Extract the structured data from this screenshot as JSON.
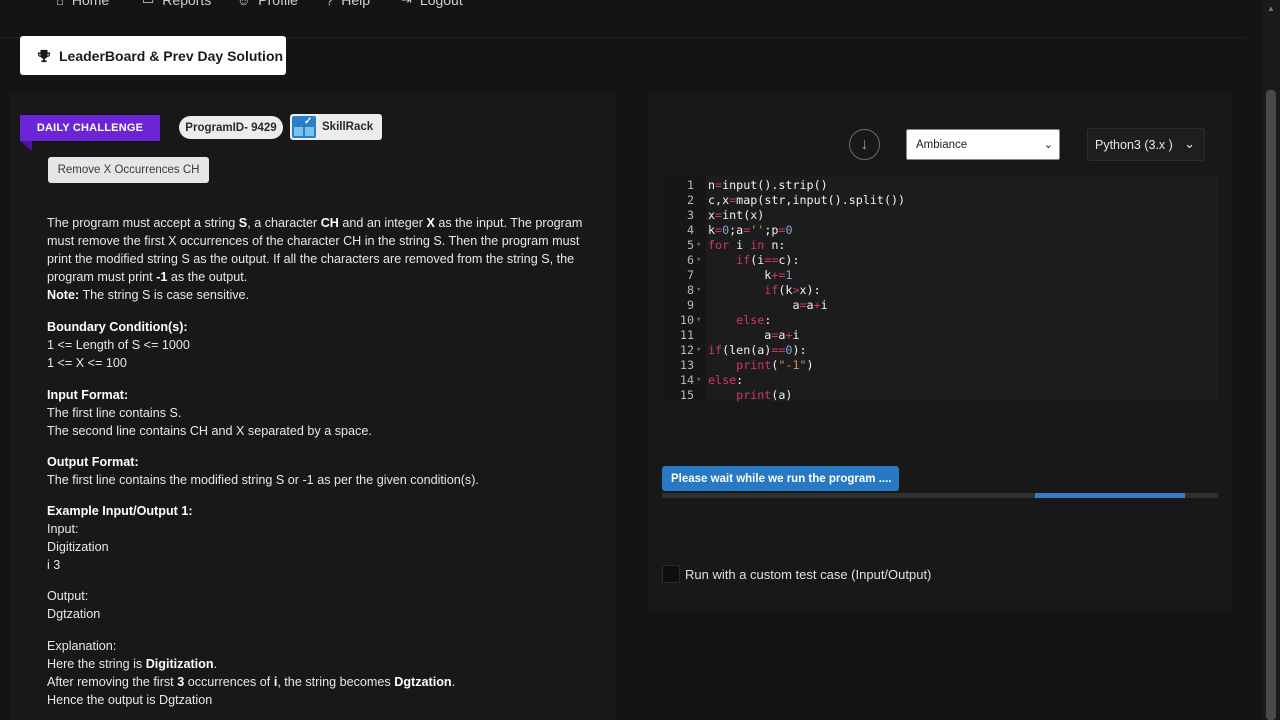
{
  "nav": {
    "items": [
      {
        "label": "Home",
        "icon": "home-icon"
      },
      {
        "label": "Reports",
        "icon": "reports-icon"
      },
      {
        "label": "Profile",
        "icon": "profile-icon"
      },
      {
        "label": "Help",
        "icon": "help-icon"
      },
      {
        "label": "Logout",
        "icon": "logout-icon"
      }
    ]
  },
  "leaderboard_label": "LeaderBoard & Prev Day Solution",
  "problem": {
    "badge": "DAILY CHALLENGE",
    "program_id": "ProgramID- 9429",
    "skillrack": "SkillRack",
    "title": "Remove X Occurrences CH",
    "desc_1a": "The program must accept a string ",
    "desc_1b": "S",
    "desc_1c": ", a character ",
    "desc_1d": "CH",
    "desc_1e": " and an integer ",
    "desc_1f": "X",
    "desc_1g": " as the input. The program must remove the first X occurrences of the character CH in the string S. Then the program must print the modified string S as the output. If all the characters are removed from the string S, the program must print ",
    "desc_1h": "-1",
    "desc_1i": " as the output.",
    "note_label": "Note:",
    "note_text": " The string S is case sensitive.",
    "boundary_title": "Boundary Condition(s):",
    "boundary_1": "1 <= Length of S <= 1000",
    "boundary_2": "1 <= X <= 100",
    "input_title": "Input Format:",
    "input_1": "The first line contains S.",
    "input_2": "The second line contains CH and X separated by a space.",
    "output_title": "Output Format:",
    "output_1": "The first line contains the modified string S or -1 as per the given condition(s).",
    "example_title": "Example Input/Output 1:",
    "ex_input_label": "Input:",
    "ex_input_1": "Digitization",
    "ex_input_2": "i 3",
    "ex_output_label": "Output:",
    "ex_output_1": "Dgtzation",
    "explanation_label": "Explanation:",
    "exp_1a": "Here the string is ",
    "exp_1b": "Digitization",
    "exp_1c": ".",
    "exp_2a": "After removing the first ",
    "exp_2b": "3",
    "exp_2c": " occurrences of ",
    "exp_2d": "i",
    "exp_2e": ", the string becomes ",
    "exp_2f": "Dgtzation",
    "exp_2g": ".",
    "exp_3": "Hence the output is Dgtzation"
  },
  "editor": {
    "theme": "Ambiance",
    "language": "Python3 (3.x )",
    "lines": [
      {
        "n": "1",
        "fold": "",
        "code": "n=input().strip()"
      },
      {
        "n": "2",
        "fold": "",
        "code": "c,x=map(str,input().split())"
      },
      {
        "n": "3",
        "fold": "",
        "code": "x=int(x)"
      },
      {
        "n": "4",
        "fold": "",
        "code": "k=0;a='';p=0"
      },
      {
        "n": "5",
        "fold": "▾",
        "code": "for i in n:"
      },
      {
        "n": "6",
        "fold": "▾",
        "code": "    if(i==c):"
      },
      {
        "n": "7",
        "fold": "",
        "code": "        k+=1"
      },
      {
        "n": "8",
        "fold": "▾",
        "code": "        if(k>x):"
      },
      {
        "n": "9",
        "fold": "",
        "code": "            a=a+i"
      },
      {
        "n": "10",
        "fold": "▾",
        "code": "    else:"
      },
      {
        "n": "11",
        "fold": "",
        "code": "        a=a+i"
      },
      {
        "n": "12",
        "fold": "▾",
        "code": "if(len(a)==0):"
      },
      {
        "n": "13",
        "fold": "",
        "code": "    print(\"-1\")"
      },
      {
        "n": "14",
        "fold": "▾",
        "code": "else:"
      },
      {
        "n": "15",
        "fold": "",
        "code": "    print(a)"
      }
    ]
  },
  "run_status": "Please wait while we run the program ....",
  "progress": {
    "start_fraction": 0.67,
    "end_fraction": 0.94
  },
  "custom_test_label": "Run with a custom test case (Input/Output)",
  "colors": {
    "badge": "#6b25d6",
    "run_button": "#2779c3",
    "keyword": "#cf3868"
  }
}
